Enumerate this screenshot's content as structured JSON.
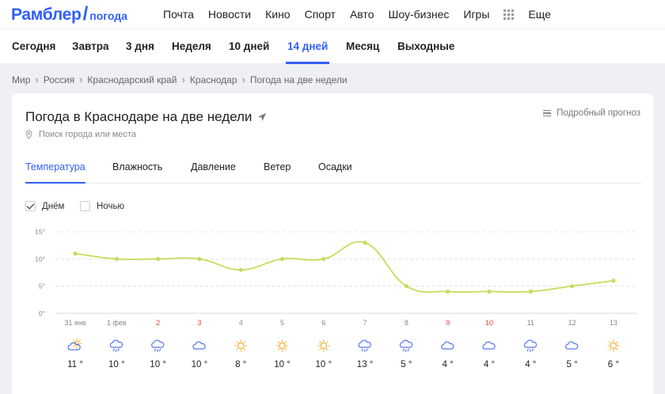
{
  "header": {
    "logo": "Рамблер",
    "logo_slash": "/",
    "logo_sub": "погода",
    "nav": [
      "Почта",
      "Новости",
      "Кино",
      "Спорт",
      "Авто",
      "Шоу-бизнес",
      "Игры"
    ],
    "more": "Еще"
  },
  "periods": {
    "items": [
      "Сегодня",
      "Завтра",
      "3 дня",
      "Неделя",
      "10 дней",
      "14 дней",
      "Месяц",
      "Выходные"
    ],
    "active": "14 дней"
  },
  "breadcrumb": [
    "Мир",
    "Россия",
    "Краснодарский край",
    "Краснодар",
    "Погода на две недели"
  ],
  "card": {
    "title": "Погода в Краснодаре на две недели",
    "search_placeholder": "Поиск города или места",
    "detail_label": "Подробный прогноз",
    "metric_tabs": [
      "Температура",
      "Влажность",
      "Давление",
      "Ветер",
      "Осадки"
    ],
    "active_metric": "Температура",
    "day_label": "Днём",
    "night_label": "Ночью",
    "day_checked": true,
    "night_checked": false
  },
  "colors": {
    "accent": "#315efb",
    "line": "#c6dc5c",
    "weekend": "#e5403d",
    "icon": "#5578f0",
    "sun": "#f0b23a"
  },
  "chart_data": {
    "type": "line",
    "y_ticks": [
      "15°",
      "10°",
      "5°",
      "0°"
    ],
    "ylim": [
      0,
      15
    ],
    "categories": [
      "31 янв",
      "1 фев",
      "2",
      "3",
      "4",
      "5",
      "6",
      "7",
      "8",
      "9",
      "10",
      "11",
      "12",
      "13"
    ],
    "weekend": [
      false,
      false,
      true,
      true,
      false,
      false,
      false,
      false,
      false,
      true,
      true,
      false,
      false,
      false
    ],
    "series": [
      {
        "values": [
          11,
          10,
          10,
          10,
          8,
          10,
          10,
          13,
          5,
          4,
          4,
          4,
          5,
          6
        ]
      }
    ],
    "temp_labels": [
      "11 °",
      "10 °",
      "10 °",
      "10 °",
      "8 °",
      "10 °",
      "10 °",
      "13 °",
      "5 °",
      "4 °",
      "4 °",
      "4 °",
      "5 °",
      "6 °"
    ],
    "icons": [
      "partly-cloudy-icon",
      "rain-icon",
      "rain-icon",
      "cloud-icon",
      "sun-icon",
      "sun-icon",
      "sun-icon",
      "rain-icon",
      "rain-icon",
      "cloud-icon",
      "cloud-icon",
      "rain-icon",
      "cloud-icon",
      "sun-icon"
    ]
  }
}
